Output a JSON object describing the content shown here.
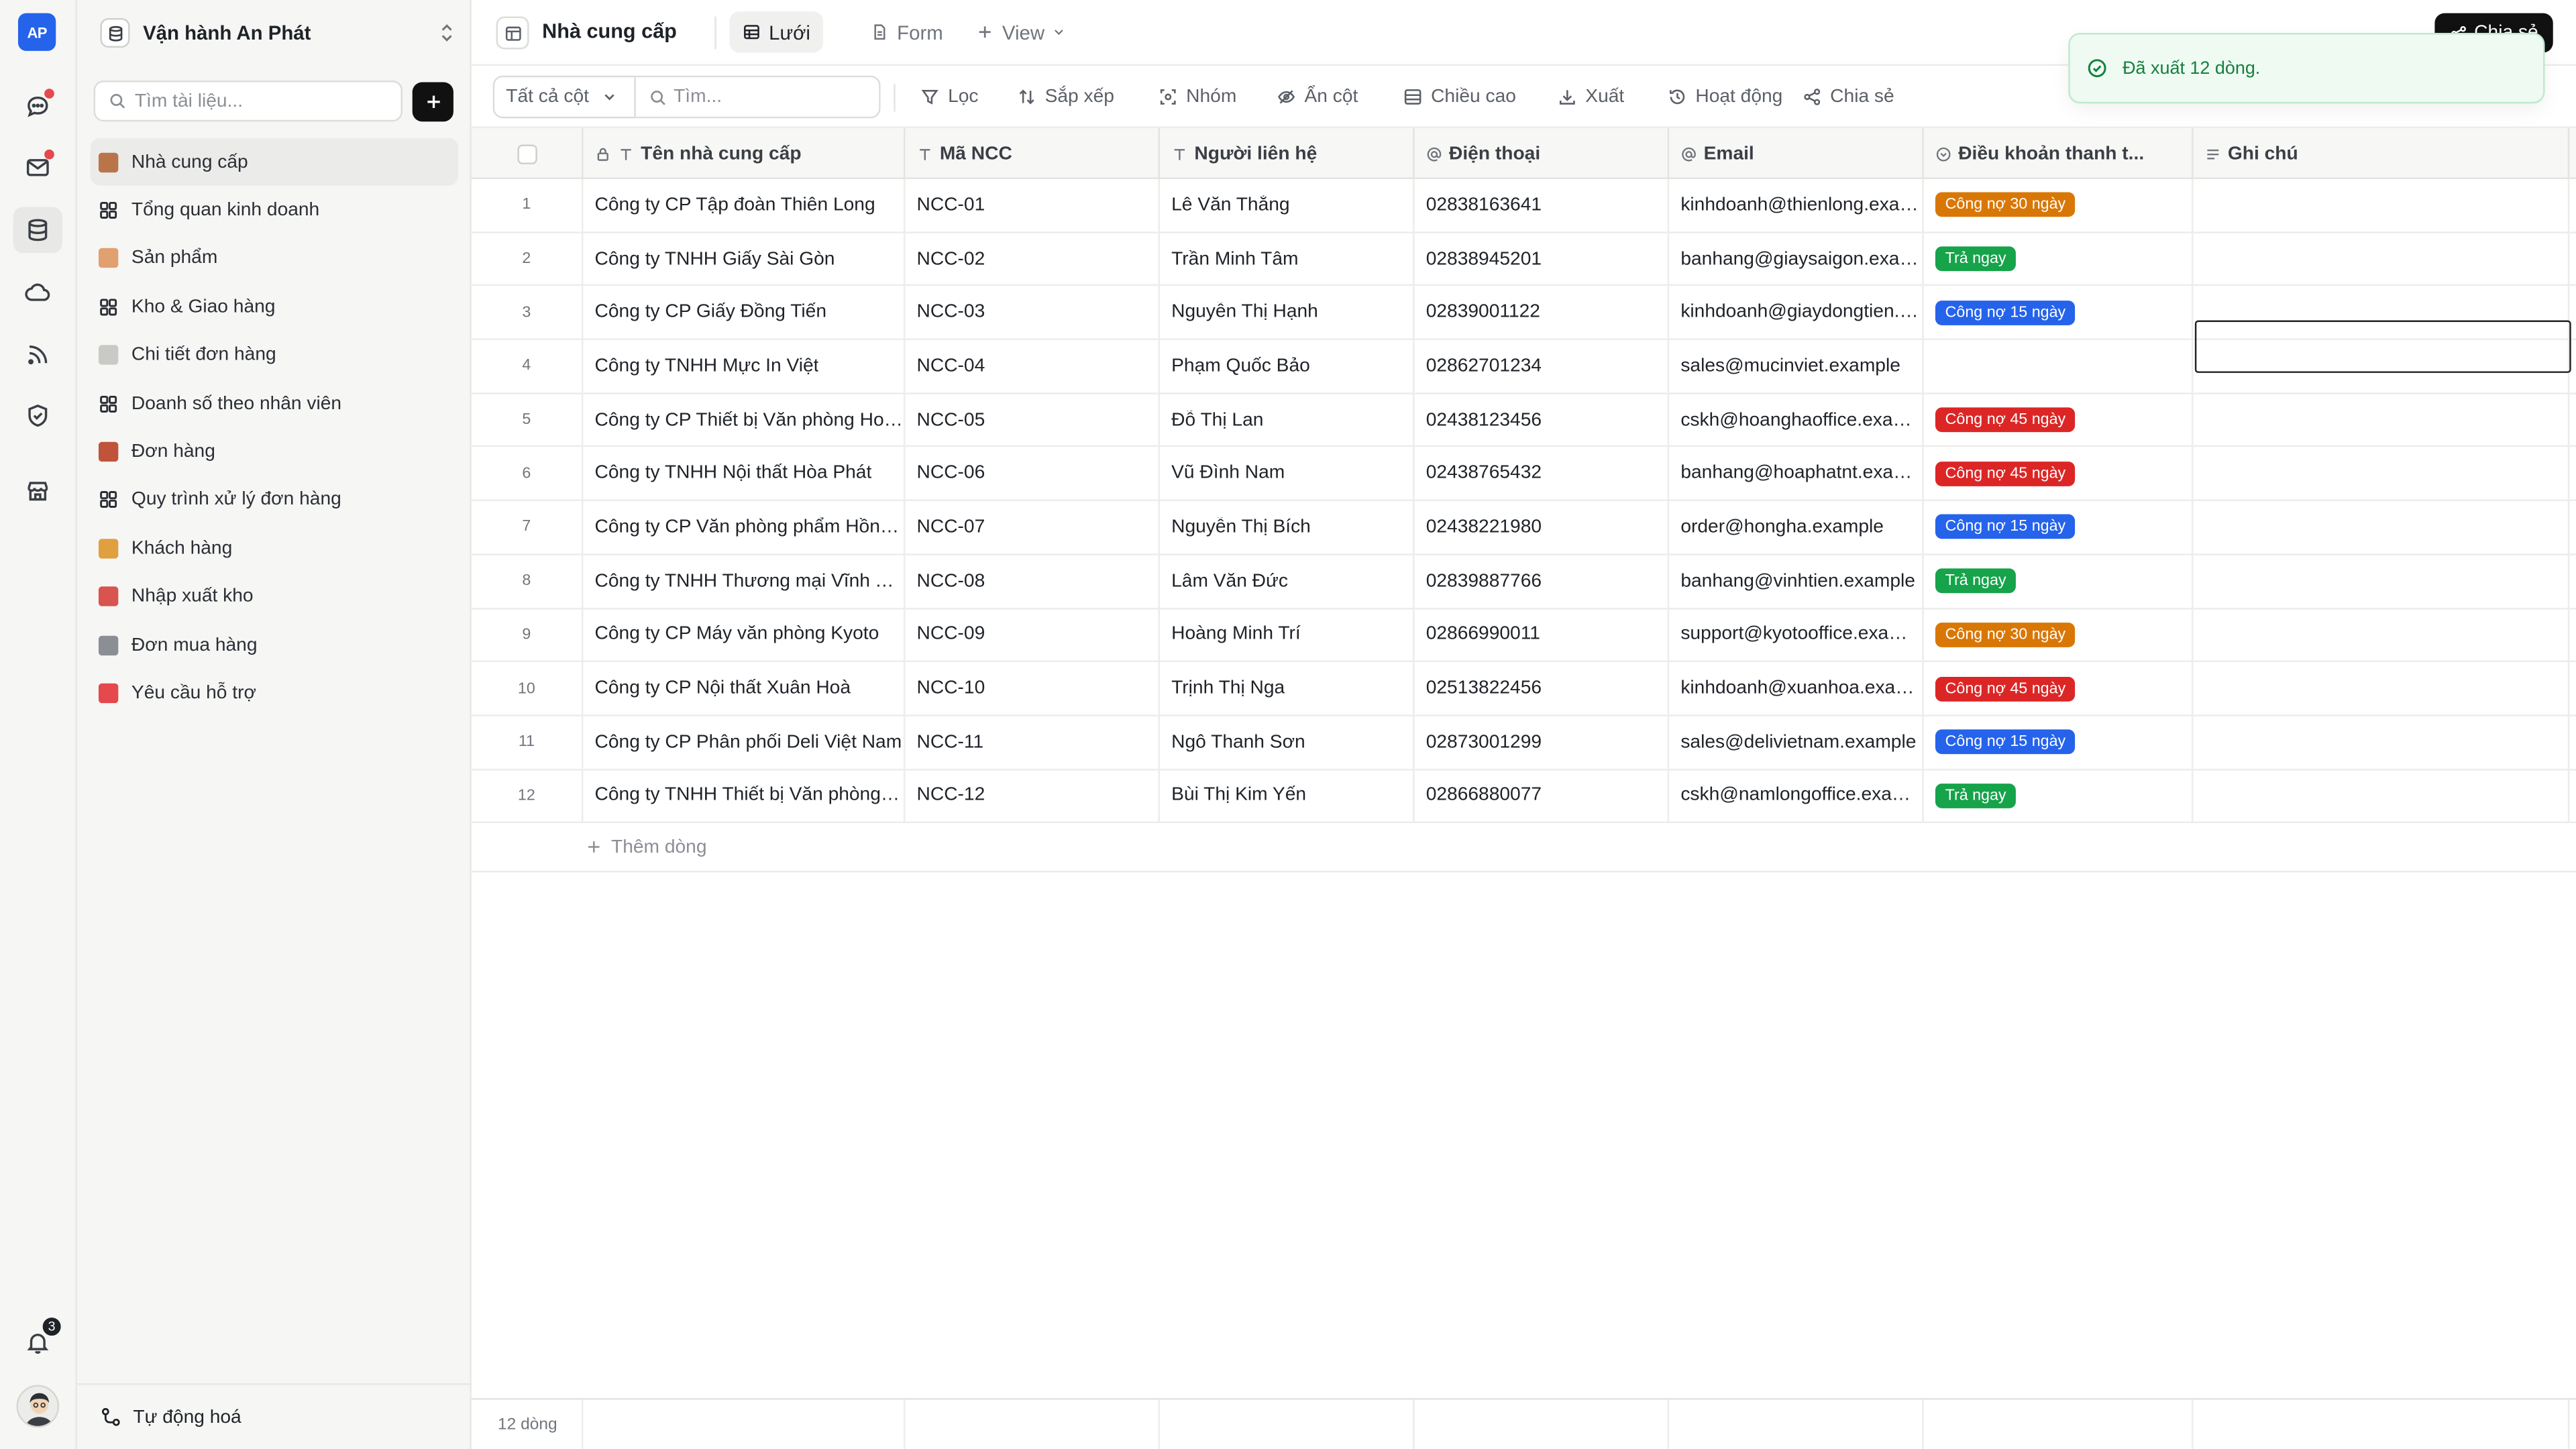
{
  "app": {
    "logo": "AP",
    "notification_count": "3"
  },
  "workspace": {
    "name": "Vận hành An Phát"
  },
  "sidebar": {
    "search_placeholder": "Tìm tài liệu...",
    "items": [
      {
        "label": "Nhà cung cấp",
        "icon": "factory-emoji",
        "color": "#b9744a",
        "active": true
      },
      {
        "label": "Tổng quan kinh doanh",
        "icon": "dashboard-grid-icon",
        "color": "#2b2f35",
        "active": false
      },
      {
        "label": "Sản phẩm",
        "icon": "box-emoji",
        "color": "#e0a070",
        "active": false
      },
      {
        "label": "Kho & Giao hàng",
        "icon": "dashboard-grid-icon",
        "color": "#2b2f35",
        "active": false
      },
      {
        "label": "Chi tiết đơn hàng",
        "icon": "receipt-emoji",
        "color": "#c9c9c6",
        "active": false
      },
      {
        "label": "Doanh số theo nhân viên",
        "icon": "dashboard-grid-icon",
        "color": "#2b2f35",
        "active": false
      },
      {
        "label": "Đơn hàng",
        "icon": "bricks-emoji",
        "color": "#c0533a",
        "active": false
      },
      {
        "label": "Quy trình xử lý đơn hàng",
        "icon": "dashboard-grid-icon",
        "color": "#2b2f35",
        "active": false
      },
      {
        "label": "Khách hàng",
        "icon": "handshake-emoji",
        "color": "#e0a040",
        "active": false
      },
      {
        "label": "Nhập xuất kho",
        "icon": "truck-emoji",
        "color": "#d9534f",
        "active": false
      },
      {
        "label": "Đơn mua hàng",
        "icon": "cart-emoji",
        "color": "#8b8f95",
        "active": false
      },
      {
        "label": "Yêu cầu hỗ trợ",
        "icon": "sos-emoji",
        "color": "#e5484d",
        "active": false
      }
    ],
    "footer_label": "Tự động hoá"
  },
  "topbar": {
    "title": "Nhà cung cấp",
    "tabs": [
      {
        "label": "Lưới",
        "icon": "grid-view-icon",
        "active": true
      },
      {
        "label": "Form",
        "icon": "form-document-icon",
        "active": false
      },
      {
        "label": "View",
        "icon": "plus-icon",
        "active": false
      }
    ],
    "share_label": "Chia sẻ"
  },
  "toolbar": {
    "column_select": "Tất cả cột",
    "search_placeholder": "Tìm...",
    "actions": [
      {
        "label": "Lọc",
        "icon": "filter-icon"
      },
      {
        "label": "Sắp xếp",
        "icon": "sort-icon"
      },
      {
        "label": "Nhóm",
        "icon": "group-icon"
      },
      {
        "label": "Ẩn cột",
        "icon": "eye-off-icon"
      },
      {
        "label": "Chiều cao",
        "icon": "row-height-icon"
      },
      {
        "label": "Xuất",
        "icon": "download-icon"
      },
      {
        "label": "Hoạt động",
        "icon": "history-icon"
      },
      {
        "label": "Chia sẻ",
        "icon": "share-icon"
      }
    ]
  },
  "grid": {
    "columns": [
      {
        "label": "Tên nhà cung cấp",
        "icon": "text-type-icon",
        "locked": true
      },
      {
        "label": "Mã NCC",
        "icon": "text-type-icon"
      },
      {
        "label": "Người liên hệ",
        "icon": "text-type-icon"
      },
      {
        "label": "Điện thoại",
        "icon": "at-sign-icon"
      },
      {
        "label": "Email",
        "icon": "at-sign-icon"
      },
      {
        "label": "Điều khoản thanh t...",
        "icon": "select-circle-icon"
      },
      {
        "label": "Ghi chú",
        "icon": "long-text-icon"
      }
    ],
    "rows": [
      {
        "no": "1",
        "name": "Công ty CP Tập đoàn Thiên Long",
        "code": "NCC-01",
        "contact": "Lê Văn Thắng",
        "phone": "02838163641",
        "email": "kinhdoanh@thienlong.example",
        "term": "Công nợ 30 ngày",
        "term_color": "#d97706",
        "note": ""
      },
      {
        "no": "2",
        "name": "Công ty TNHH Giấy Sài Gòn",
        "code": "NCC-02",
        "contact": "Trần Minh Tâm",
        "phone": "02838945201",
        "email": "banhang@giaysaigon.example",
        "term": "Trả ngay",
        "term_color": "#16a34a",
        "note": ""
      },
      {
        "no": "3",
        "name": "Công ty CP Giấy Đồng Tiến",
        "code": "NCC-03",
        "contact": "Nguyễn Thị Hạnh",
        "phone": "02839001122",
        "email": "kinhdoanh@giaydongtien.example",
        "term": "Công nợ 15 ngày",
        "term_color": "#2563eb",
        "note": ""
      },
      {
        "no": "4",
        "name": "Công ty TNHH Mực In Việt",
        "code": "NCC-04",
        "contact": "Phạm Quốc Bảo",
        "phone": "02862701234",
        "email": "sales@mucinviet.example",
        "term": "",
        "term_color": "",
        "note": ""
      },
      {
        "no": "5",
        "name": "Công ty CP Thiết bị Văn phòng Hoàng Hà",
        "code": "NCC-05",
        "contact": "Đỗ Thị Lan",
        "phone": "02438123456",
        "email": "cskh@hoanghaoffice.example",
        "term": "Công nợ 45 ngày",
        "term_color": "#dc2626",
        "note": ""
      },
      {
        "no": "6",
        "name": "Công ty TNHH Nội thất Hòa Phát",
        "code": "NCC-06",
        "contact": "Vũ Đình Nam",
        "phone": "02438765432",
        "email": "banhang@hoaphatnt.example",
        "term": "Công nợ 45 ngày",
        "term_color": "#dc2626",
        "note": ""
      },
      {
        "no": "7",
        "name": "Công ty CP Văn phòng phẩm Hồng Hà",
        "code": "NCC-07",
        "contact": "Nguyễn Thị Bích",
        "phone": "02438221980",
        "email": "order@hongha.example",
        "term": "Công nợ 15 ngày",
        "term_color": "#2563eb",
        "note": ""
      },
      {
        "no": "8",
        "name": "Công ty TNHH Thương mại Vĩnh Tiến",
        "code": "NCC-08",
        "contact": "Lâm Văn Đức",
        "phone": "02839887766",
        "email": "banhang@vinhtien.example",
        "term": "Trả ngay",
        "term_color": "#16a34a",
        "note": ""
      },
      {
        "no": "9",
        "name": "Công ty CP Máy văn phòng Kyoto",
        "code": "NCC-09",
        "contact": "Hoàng Minh Trí",
        "phone": "02866990011",
        "email": "support@kyotooffice.example",
        "term": "Công nợ 30 ngày",
        "term_color": "#d97706",
        "note": ""
      },
      {
        "no": "10",
        "name": "Công ty CP Nội thất Xuân Hoà",
        "code": "NCC-10",
        "contact": "Trịnh Thị Nga",
        "phone": "02513822456",
        "email": "kinhdoanh@xuanhoa.example",
        "term": "Công nợ 45 ngày",
        "term_color": "#dc2626",
        "note": ""
      },
      {
        "no": "11",
        "name": "Công ty CP Phân phối Deli Việt Nam",
        "code": "NCC-11",
        "contact": "Ngô Thanh Sơn",
        "phone": "02873001299",
        "email": "sales@delivietnam.example",
        "term": "Công nợ 15 ngày",
        "term_color": "#2563eb",
        "note": ""
      },
      {
        "no": "12",
        "name": "Công ty TNHH Thiết bị Văn phòng Nam Long",
        "code": "NCC-12",
        "contact": "Bùi Thị Kim Yến",
        "phone": "02866880077",
        "email": "cskh@namlongoffice.example",
        "term": "Trả ngay",
        "term_color": "#16a34a",
        "note": ""
      }
    ],
    "add_row_label": "Thêm dòng",
    "row_count_label": "12 dòng"
  },
  "toast": {
    "message": "Đã xuất 12 dòng."
  }
}
